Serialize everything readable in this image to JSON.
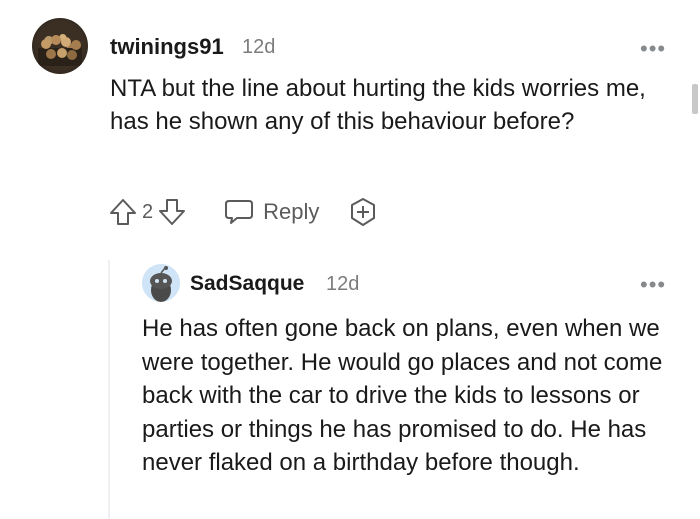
{
  "comment": {
    "author": "twinings91",
    "time": "12d",
    "more": "•••",
    "body": "NTA but the line about hurting the kids worries me, has he shown any of this behaviour before?",
    "votes": "2",
    "reply_label": "Reply"
  },
  "reply": {
    "author": "SadSaqque",
    "time": "12d",
    "more": "•••",
    "body": "He has often gone back on plans, even when we were together. He would go places and not come back with the car to drive the kids to lessons or parties or things he has promised to do. He has never flaked on a birthday before though."
  },
  "icons": {
    "upvote": "arrow-up-icon",
    "downvote": "arrow-down-icon",
    "reply": "speech-bubble-icon",
    "award": "award-plus-icon",
    "more": "more-dots-icon"
  }
}
